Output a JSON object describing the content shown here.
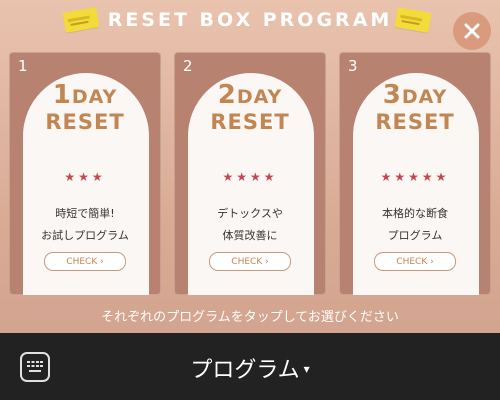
{
  "header": {
    "title": "RESET BOX PROGRAM"
  },
  "cards": [
    {
      "number": "1",
      "day_num": "1",
      "day_word": "DAY",
      "reset": "RESET",
      "stars": "★★★",
      "desc_line1": "時短で簡単!",
      "desc_line2": "お試しプログラム",
      "button": "CHECK ›"
    },
    {
      "number": "2",
      "day_num": "2",
      "day_word": "DAY",
      "reset": "RESET",
      "stars": "★★★★",
      "desc_line1": "デトックスや",
      "desc_line2": "体質改善に",
      "button": "CHECK ›"
    },
    {
      "number": "3",
      "day_num": "3",
      "day_word": "DAY",
      "reset": "RESET",
      "stars": "★★★★★",
      "desc_line1": "本格的な断食",
      "desc_line2": "プログラム",
      "button": "CHECK ›"
    }
  ],
  "instruction": "それぞれのプログラムをタップしてお選びください",
  "bottom": {
    "menu_label": "プログラム",
    "caret": "▾"
  },
  "colors": {
    "accent": "#c28653",
    "star": "#c7474e",
    "bar": "#222222"
  }
}
